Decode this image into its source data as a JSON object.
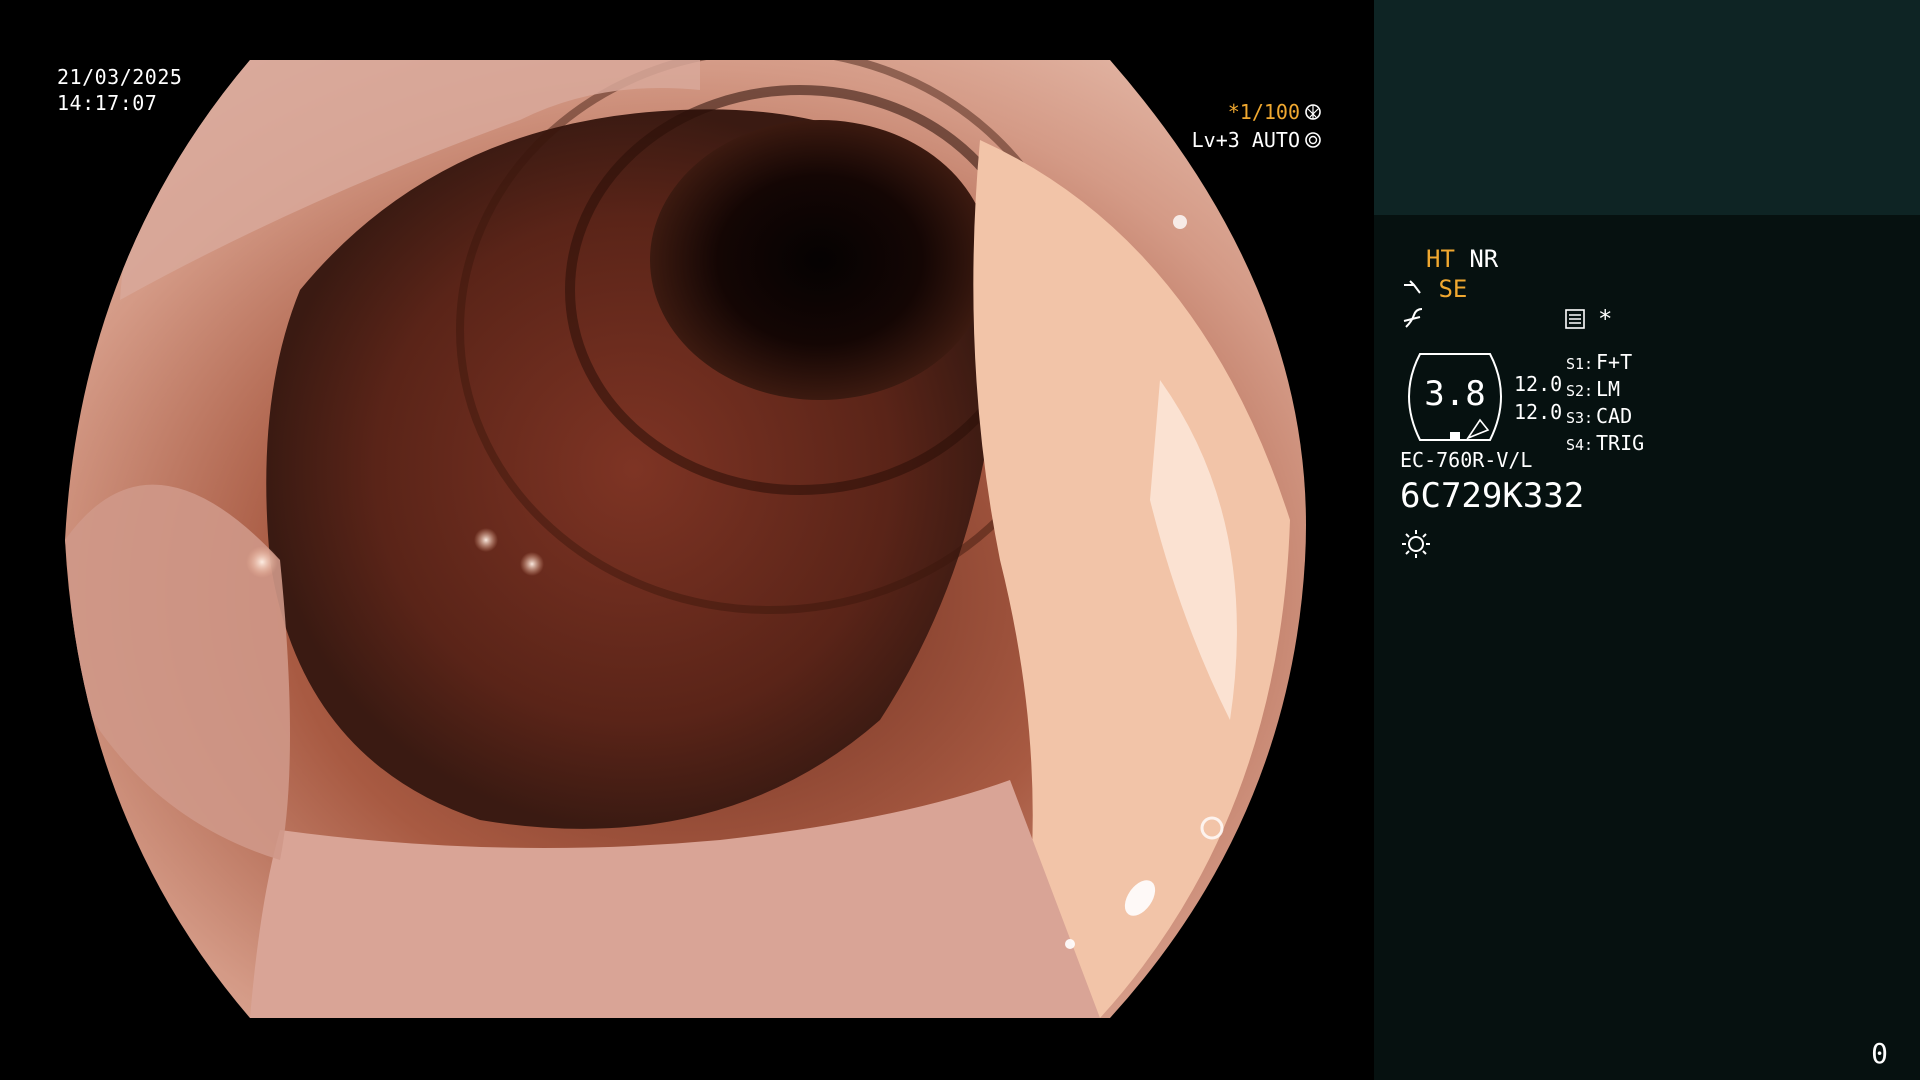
{
  "overlay": {
    "date": "21/03/2025",
    "time": "14:17:07",
    "shutter": "*1/100",
    "shutter_icon": "aperture-icon",
    "light_level": "Lv+3 AUTO",
    "light_icon": "iris-icon"
  },
  "panel": {
    "mode_ht": "HT",
    "mode_nr": "NR",
    "mode_se": "SE",
    "asterisk": "*",
    "zoom_value": "3.8",
    "value_1": "12.0",
    "value_2": "12.0",
    "switches": [
      {
        "key": "S1:",
        "value": "F+T"
      },
      {
        "key": "S2:",
        "value": "LM"
      },
      {
        "key": "S3:",
        "value": "CAD"
      },
      {
        "key": "S4:",
        "value": "TRIG"
      }
    ],
    "scope_model": "EC-760R-V/L",
    "serial": "6C729K332",
    "counter": "0"
  },
  "colors": {
    "highlight": "#f0a830",
    "panel_top": "#0e2424",
    "panel_bottom": "#061110"
  }
}
